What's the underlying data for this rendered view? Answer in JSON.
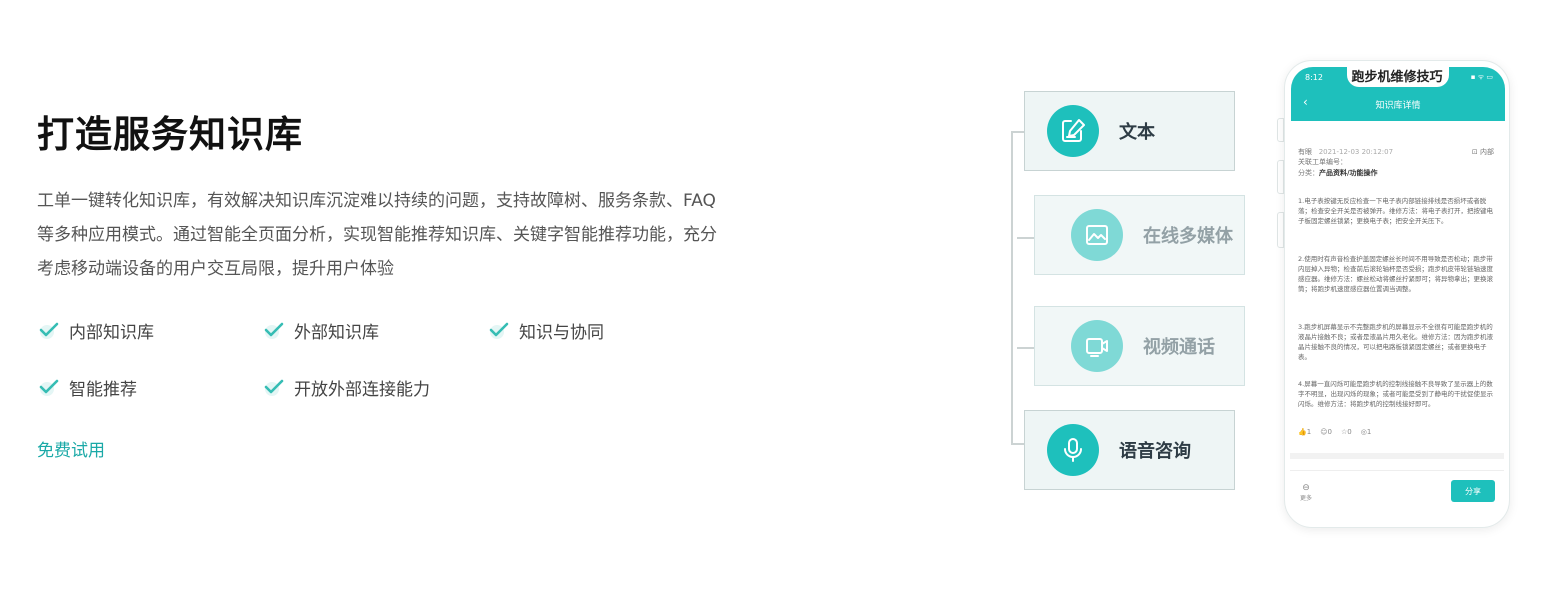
{
  "title": "打造服务知识库",
  "description": "工单一键转化知识库，有效解决知识库沉淀难以持续的问题，支持故障树、服务条款、FAQ等多种应用模式。通过智能全页面分析，实现智能推荐知识库、关键字智能推荐功能，充分考虑移动端设备的用户交互局限，提升用户体验",
  "features": [
    "内部知识库",
    "外部知识库",
    "知识与协同",
    "智能推荐",
    "开放外部连接能力"
  ],
  "trial_link": "免费试用",
  "colors": {
    "accent": "#1ec0bc",
    "link": "#1aa9a7",
    "check": "#36bdb4"
  },
  "cards": [
    {
      "label": "文本",
      "icon": "edit-document-icon"
    },
    {
      "label": "在线多媒体",
      "icon": "image-icon"
    },
    {
      "label": "视频通话",
      "icon": "video-camera-icon"
    },
    {
      "label": "语音咨询",
      "icon": "microphone-icon"
    }
  ],
  "phone": {
    "time": "8:12",
    "status": "▪ ᯤ ▭",
    "nav_title": "知识库详情",
    "article_title": "跑步机维修技巧",
    "author": "有眼",
    "date": "2021-12-03 20:12:07",
    "visibility": "内部",
    "ticket_label": "关联工单编号：",
    "category_label": "分类：",
    "category_value": "产品资料/功能操作",
    "paragraphs": [
      "1.电子表按键无反应检查一下电子表内部链接排线是否损坏或者脱落；检查安全开关是否被弹开。维修方法：将电子表打开，把按键电子板固定螺丝锁紧；更换电子表；把安全开关压下。",
      "2.使用时有声音检查护盖固定螺丝长时间不用导致是否松动；跑步带内层掉入异物；检查前后滚轮轴杯是否受损；跑步机皮带轮链轴速度感应器。维修方法：螺丝松动将螺丝拧紧即可；将异物拿出；更换滚筒；将跑步机速度感应器位置调当调整。",
      "3.跑步机屏幕显示不完整跑步机的屏幕显示不全很有可能是跑步机的液晶片接触不良；或者是液晶片用久老化。维修方法：因为跑步机液晶片接触不良的情况，可以把电路板锁紧固定螺丝；或者更换电子表。",
      "4.屏幕一直闪烁可能是跑步机的控制线接触不良导致了显示器上的数字不明显，出现闪烁的现象；或者可能是受到了静电的干扰促使显示闪烁。维修方法：将跑步机的控制线接好即可。"
    ],
    "likes": "1",
    "comments": "0",
    "stars": "0",
    "views": "1",
    "more_label": "更多",
    "share_label": "分享"
  }
}
